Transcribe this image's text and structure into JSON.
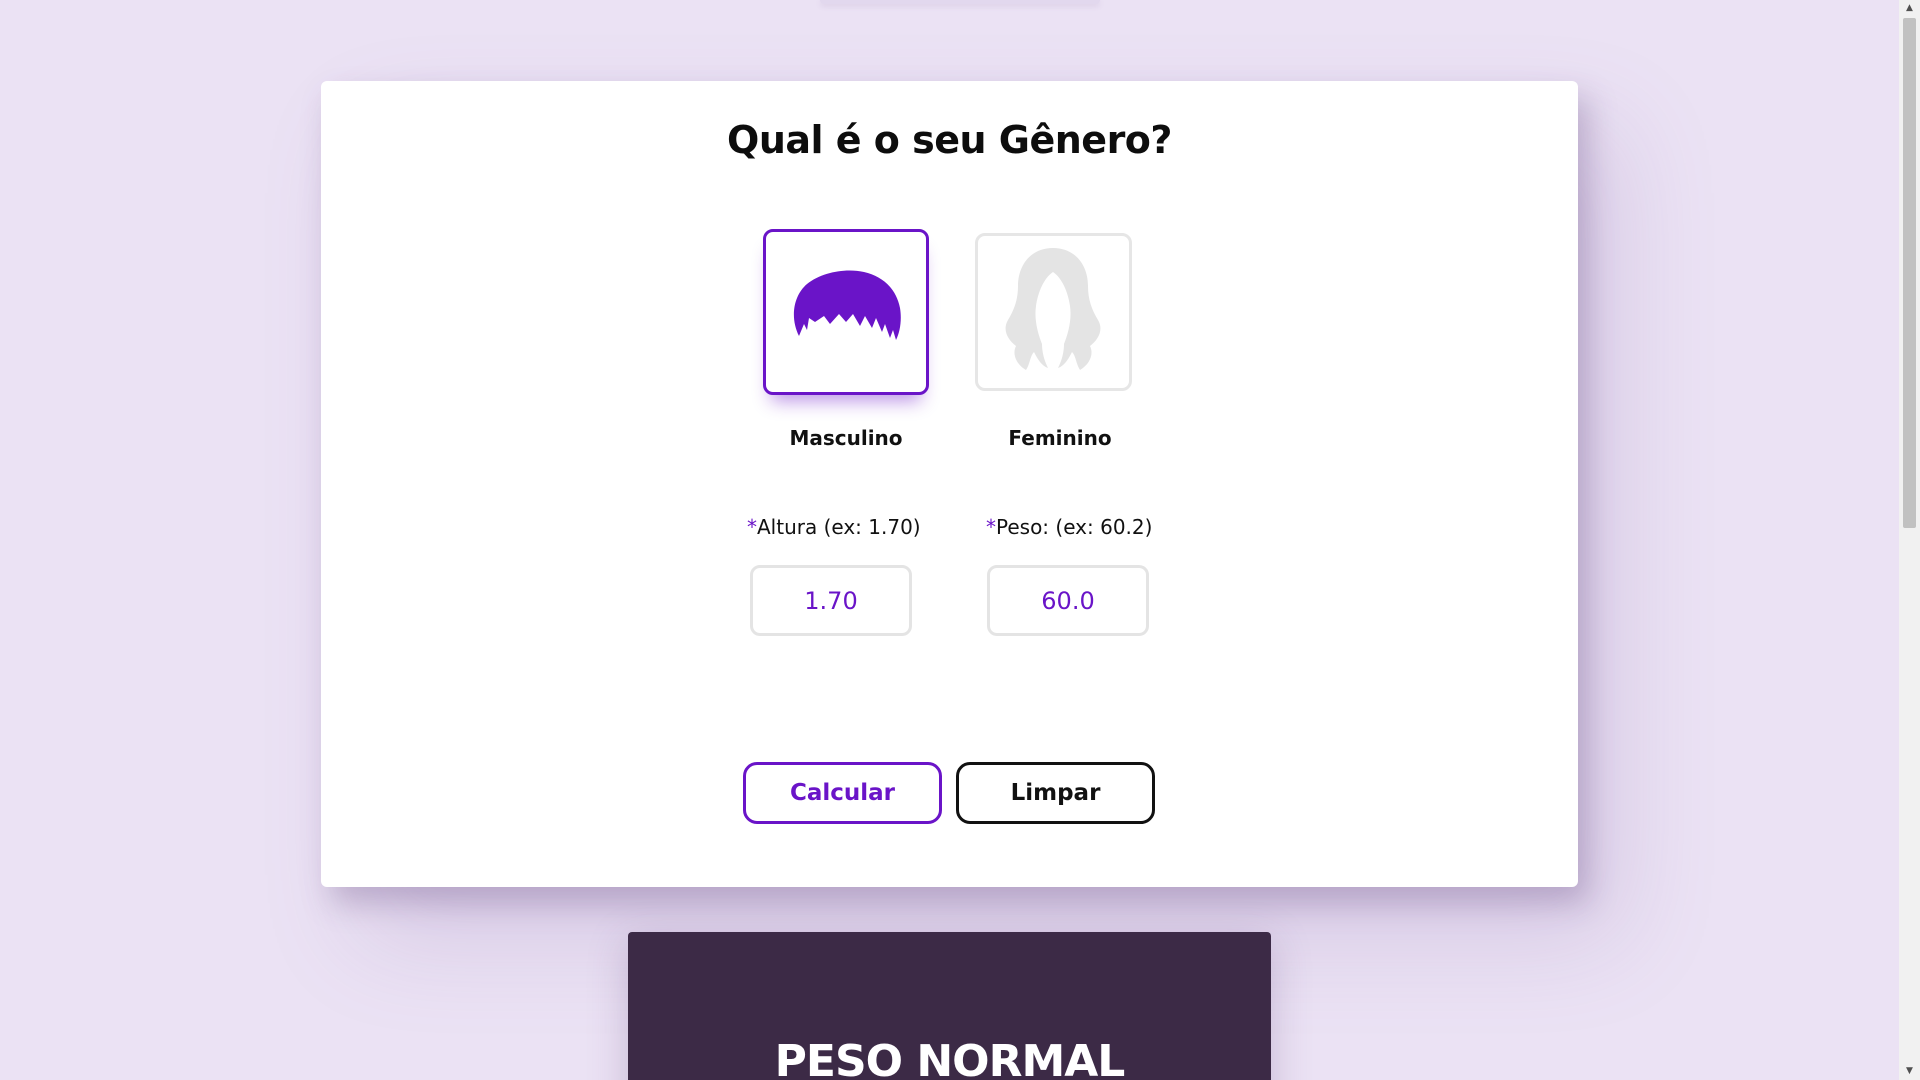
{
  "form": {
    "title": "Qual é o seu Gênero?",
    "gender_options": [
      {
        "label": "Masculino",
        "selected": true
      },
      {
        "label": "Feminino",
        "selected": false
      }
    ],
    "fields": {
      "required_mark": "*",
      "altura": {
        "label": "Altura (ex: 1.70)",
        "value": "1.70"
      },
      "peso": {
        "label": "Peso: (ex: 60.2)",
        "value": "60.0"
      }
    },
    "buttons": {
      "calculate": "Calcular",
      "clear": "Limpar"
    }
  },
  "result": {
    "title": "PESO NORMAL"
  },
  "colors": {
    "accent": "#6a14c8",
    "background": "#ebe2f4",
    "result_card": "#3c2a46",
    "inactive_icon": "#e4e4e4"
  },
  "icons": {
    "male": "male-hair-icon",
    "female": "female-hair-icon",
    "scroll_up": "scroll-up-arrow-icon",
    "scroll_down": "scroll-down-arrow-icon"
  }
}
